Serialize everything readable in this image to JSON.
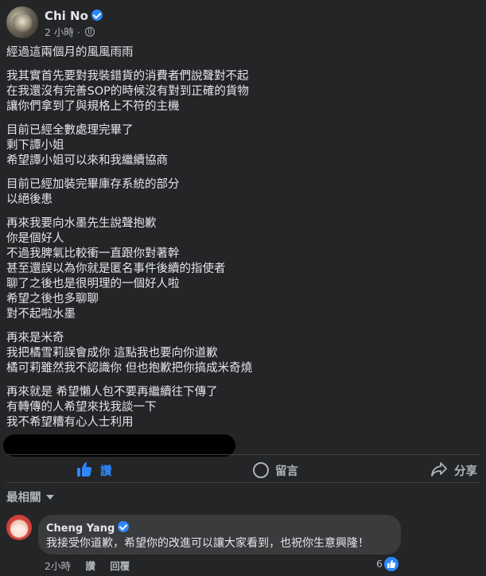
{
  "post": {
    "author": "Chi No",
    "time": "2 小時 · ",
    "paragraphs": [
      [
        "經過這兩個月的風風雨雨"
      ],
      [
        "我其實首先要對我裝錯貨的消費者們說聲對不起",
        "在我還沒有完善SOP的時候沒有對到正確的貨物",
        "讓你們拿到了與規格上不符的主機"
      ],
      [
        "目前已經全數處理完畢了",
        "剩下譚小姐",
        "希望譚小姐可以來和我繼續協商"
      ],
      [
        "目前已經加裝完畢庫存系統的部分",
        "以絕後患"
      ],
      [
        "再來我要向水墨先生說聲抱歉",
        "你是個好人",
        "不過我脾氣比較衝一直跟你對著幹",
        "甚至還誤以為你就是匿名事件後續的指使者",
        "聊了之後也是很明理的一個好人啦",
        "希望之後也多聊聊",
        "對不起啦水墨"
      ],
      [
        "再來是米奇",
        "我把橘雪莉誤會成你  這點我也要向你道歉",
        "橘可莉雖然我不認識你  但也抱歉把你搞成米奇燒"
      ],
      [
        "再來就是  希望懶人包不要再繼續往下傳了",
        "有轉傳的人希望來找我談一下",
        "我不希望糟有心人士利用"
      ]
    ]
  },
  "actions": {
    "like": "讚",
    "comment": "留言",
    "share": "分享"
  },
  "comments_filter": "最相關",
  "comment": {
    "author": "Cheng Yang",
    "text": "我接受你道歉，希望你的改進可以讓大家看到，也祝你生意興隆！",
    "time": "2小時",
    "like_label": "讚",
    "reply_label": "回覆",
    "reaction_count": "6"
  },
  "colors": {
    "background": "#242526",
    "text": "#e4e6eb",
    "muted": "#b0b3b8",
    "accent": "#2d88ff",
    "bubble": "#3a3b3c"
  }
}
